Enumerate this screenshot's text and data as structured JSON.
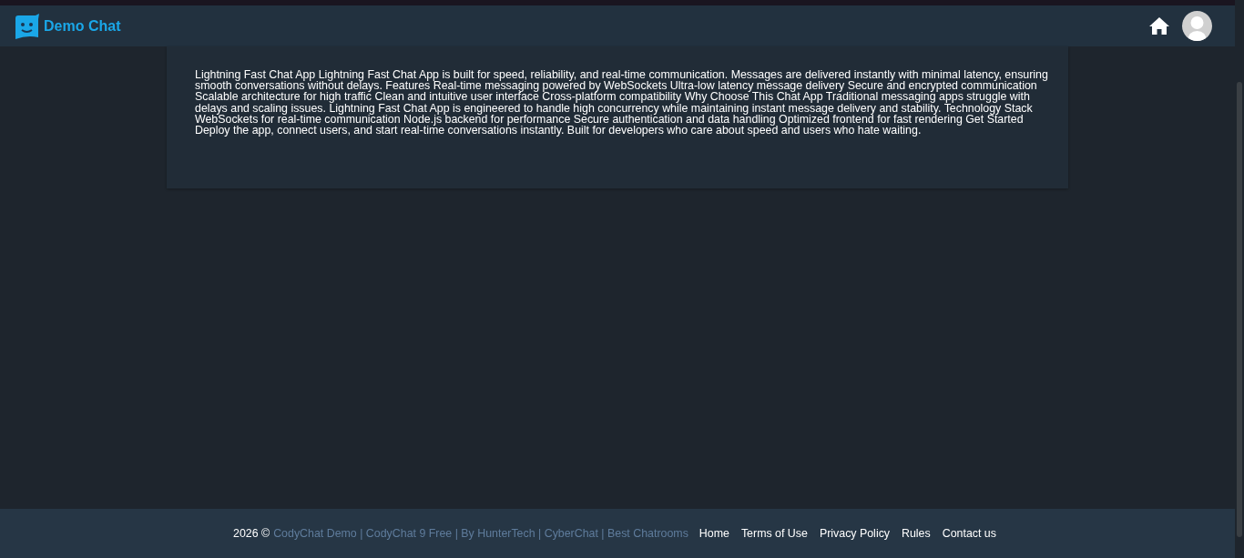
{
  "header": {
    "logo_text": "Demo Chat"
  },
  "content": {
    "text": "Lightning Fast Chat App Lightning Fast Chat App is built for speed, reliability, and real-time communication. Messages are delivered instantly with minimal latency, ensuring smooth conversations without delays. Features Real-time messaging powered by WebSockets Ultra-low latency message delivery Secure and encrypted communication Scalable architecture for high traffic Clean and intuitive user interface Cross-platform compatibility Why Choose This Chat App Traditional messaging apps struggle with delays and scaling issues. Lightning Fast Chat App is engineered to handle high concurrency while maintaining instant message delivery and stability. Technology Stack WebSockets for real-time communication Node.js backend for performance Secure authentication and data handling Optimized frontend for fast rendering Get Started Deploy the app, connect users, and start real-time conversations instantly. Built for developers who care about speed and users who hate waiting."
  },
  "footer": {
    "copyright": "2026 ©",
    "credits": "CodyChat Demo | CodyChat 9 Free | By HunterTech | CyberChat | Best Chatrooms",
    "links": [
      "Home",
      "Terms of Use",
      "Privacy Policy",
      "Rules",
      "Contact us"
    ]
  }
}
